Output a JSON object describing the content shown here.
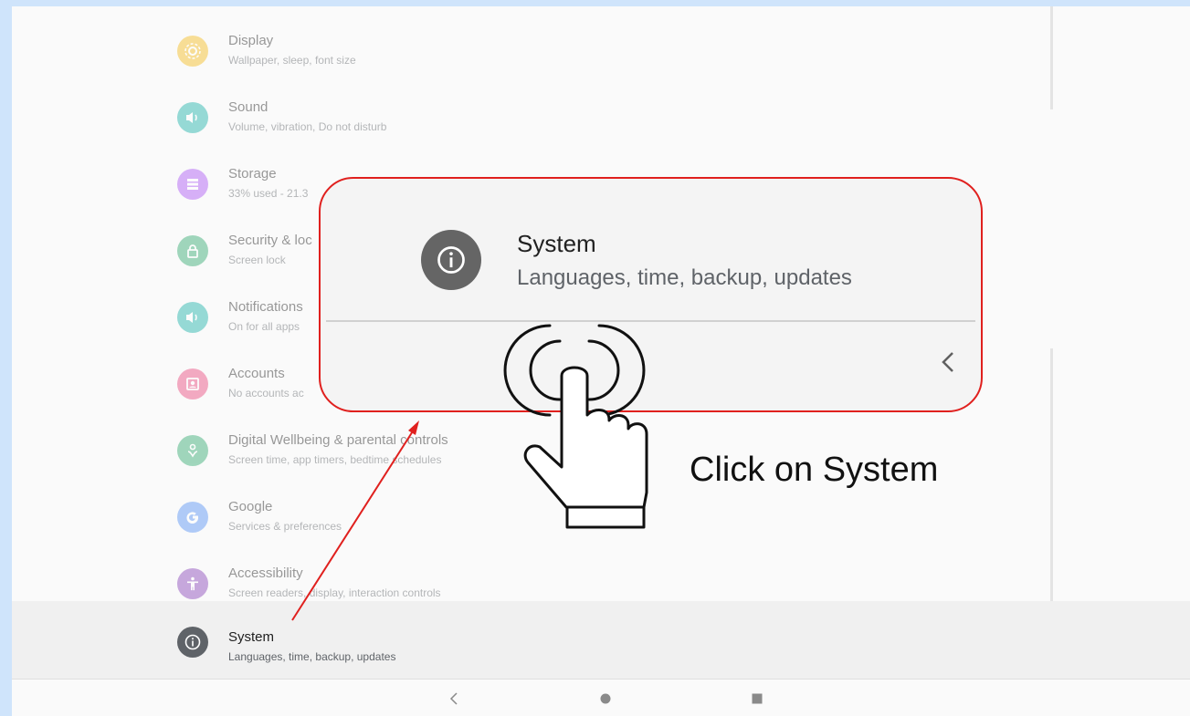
{
  "settings_items": [
    {
      "title": "Display",
      "subtitle": "Wallpaper, sleep, font size",
      "icon": "display-icon",
      "color": "#f5b400"
    },
    {
      "title": "Sound",
      "subtitle": "Volume, vibration, Do not disturb",
      "icon": "sound-icon",
      "color": "#00a8a0"
    },
    {
      "title": "Storage",
      "subtitle": "33% used - 21.3",
      "icon": "storage-icon",
      "color": "#a142f4"
    },
    {
      "title": "Security & loc",
      "subtitle": "Screen lock",
      "icon": "lock-icon",
      "color": "#18a05e"
    },
    {
      "title": "Notifications",
      "subtitle": "On for all apps",
      "icon": "notifications-icon",
      "color": "#00a8a0"
    },
    {
      "title": "Accounts",
      "subtitle": "No accounts ac",
      "icon": "accounts-icon",
      "color": "#e8336d"
    },
    {
      "title": "Digital Wellbeing & parental controls",
      "subtitle": "Screen time, app timers, bedtime schedules",
      "icon": "wellbeing-icon",
      "color": "#18a05e"
    },
    {
      "title": "Google",
      "subtitle": "Services & preferences",
      "icon": "google-icon",
      "color": "#4285f4"
    },
    {
      "title": "Accessibility",
      "subtitle": "Screen readers, display, interaction controls",
      "icon": "accessibility-icon",
      "color": "#7b2cb0"
    },
    {
      "title": "System",
      "subtitle": "Languages, time, backup, updates",
      "icon": "info-icon",
      "color": "#5f6368"
    }
  ],
  "callout": {
    "title": "System",
    "subtitle": "Languages, time, backup, updates"
  },
  "instruction": "Click on System",
  "colors": {
    "annotation": "#e0201e",
    "screen_bg": "#cfe4fb"
  },
  "navbar": {
    "back_icon": "back-icon",
    "home_icon": "home-icon",
    "recents_icon": "recents-icon"
  }
}
